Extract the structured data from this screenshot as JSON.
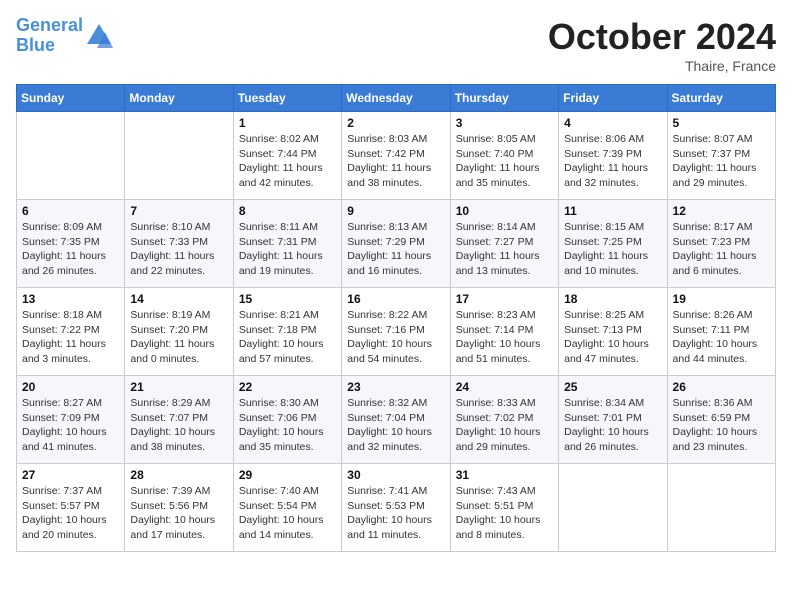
{
  "header": {
    "logo_line1": "General",
    "logo_line2": "Blue",
    "month": "October 2024",
    "location": "Thaire, France"
  },
  "weekdays": [
    "Sunday",
    "Monday",
    "Tuesday",
    "Wednesday",
    "Thursday",
    "Friday",
    "Saturday"
  ],
  "weeks": [
    [
      {
        "day": "",
        "sunrise": "",
        "sunset": "",
        "daylight": ""
      },
      {
        "day": "",
        "sunrise": "",
        "sunset": "",
        "daylight": ""
      },
      {
        "day": "1",
        "sunrise": "Sunrise: 8:02 AM",
        "sunset": "Sunset: 7:44 PM",
        "daylight": "Daylight: 11 hours and 42 minutes."
      },
      {
        "day": "2",
        "sunrise": "Sunrise: 8:03 AM",
        "sunset": "Sunset: 7:42 PM",
        "daylight": "Daylight: 11 hours and 38 minutes."
      },
      {
        "day": "3",
        "sunrise": "Sunrise: 8:05 AM",
        "sunset": "Sunset: 7:40 PM",
        "daylight": "Daylight: 11 hours and 35 minutes."
      },
      {
        "day": "4",
        "sunrise": "Sunrise: 8:06 AM",
        "sunset": "Sunset: 7:39 PM",
        "daylight": "Daylight: 11 hours and 32 minutes."
      },
      {
        "day": "5",
        "sunrise": "Sunrise: 8:07 AM",
        "sunset": "Sunset: 7:37 PM",
        "daylight": "Daylight: 11 hours and 29 minutes."
      }
    ],
    [
      {
        "day": "6",
        "sunrise": "Sunrise: 8:09 AM",
        "sunset": "Sunset: 7:35 PM",
        "daylight": "Daylight: 11 hours and 26 minutes."
      },
      {
        "day": "7",
        "sunrise": "Sunrise: 8:10 AM",
        "sunset": "Sunset: 7:33 PM",
        "daylight": "Daylight: 11 hours and 22 minutes."
      },
      {
        "day": "8",
        "sunrise": "Sunrise: 8:11 AM",
        "sunset": "Sunset: 7:31 PM",
        "daylight": "Daylight: 11 hours and 19 minutes."
      },
      {
        "day": "9",
        "sunrise": "Sunrise: 8:13 AM",
        "sunset": "Sunset: 7:29 PM",
        "daylight": "Daylight: 11 hours and 16 minutes."
      },
      {
        "day": "10",
        "sunrise": "Sunrise: 8:14 AM",
        "sunset": "Sunset: 7:27 PM",
        "daylight": "Daylight: 11 hours and 13 minutes."
      },
      {
        "day": "11",
        "sunrise": "Sunrise: 8:15 AM",
        "sunset": "Sunset: 7:25 PM",
        "daylight": "Daylight: 11 hours and 10 minutes."
      },
      {
        "day": "12",
        "sunrise": "Sunrise: 8:17 AM",
        "sunset": "Sunset: 7:23 PM",
        "daylight": "Daylight: 11 hours and 6 minutes."
      }
    ],
    [
      {
        "day": "13",
        "sunrise": "Sunrise: 8:18 AM",
        "sunset": "Sunset: 7:22 PM",
        "daylight": "Daylight: 11 hours and 3 minutes."
      },
      {
        "day": "14",
        "sunrise": "Sunrise: 8:19 AM",
        "sunset": "Sunset: 7:20 PM",
        "daylight": "Daylight: 11 hours and 0 minutes."
      },
      {
        "day": "15",
        "sunrise": "Sunrise: 8:21 AM",
        "sunset": "Sunset: 7:18 PM",
        "daylight": "Daylight: 10 hours and 57 minutes."
      },
      {
        "day": "16",
        "sunrise": "Sunrise: 8:22 AM",
        "sunset": "Sunset: 7:16 PM",
        "daylight": "Daylight: 10 hours and 54 minutes."
      },
      {
        "day": "17",
        "sunrise": "Sunrise: 8:23 AM",
        "sunset": "Sunset: 7:14 PM",
        "daylight": "Daylight: 10 hours and 51 minutes."
      },
      {
        "day": "18",
        "sunrise": "Sunrise: 8:25 AM",
        "sunset": "Sunset: 7:13 PM",
        "daylight": "Daylight: 10 hours and 47 minutes."
      },
      {
        "day": "19",
        "sunrise": "Sunrise: 8:26 AM",
        "sunset": "Sunset: 7:11 PM",
        "daylight": "Daylight: 10 hours and 44 minutes."
      }
    ],
    [
      {
        "day": "20",
        "sunrise": "Sunrise: 8:27 AM",
        "sunset": "Sunset: 7:09 PM",
        "daylight": "Daylight: 10 hours and 41 minutes."
      },
      {
        "day": "21",
        "sunrise": "Sunrise: 8:29 AM",
        "sunset": "Sunset: 7:07 PM",
        "daylight": "Daylight: 10 hours and 38 minutes."
      },
      {
        "day": "22",
        "sunrise": "Sunrise: 8:30 AM",
        "sunset": "Sunset: 7:06 PM",
        "daylight": "Daylight: 10 hours and 35 minutes."
      },
      {
        "day": "23",
        "sunrise": "Sunrise: 8:32 AM",
        "sunset": "Sunset: 7:04 PM",
        "daylight": "Daylight: 10 hours and 32 minutes."
      },
      {
        "day": "24",
        "sunrise": "Sunrise: 8:33 AM",
        "sunset": "Sunset: 7:02 PM",
        "daylight": "Daylight: 10 hours and 29 minutes."
      },
      {
        "day": "25",
        "sunrise": "Sunrise: 8:34 AM",
        "sunset": "Sunset: 7:01 PM",
        "daylight": "Daylight: 10 hours and 26 minutes."
      },
      {
        "day": "26",
        "sunrise": "Sunrise: 8:36 AM",
        "sunset": "Sunset: 6:59 PM",
        "daylight": "Daylight: 10 hours and 23 minutes."
      }
    ],
    [
      {
        "day": "27",
        "sunrise": "Sunrise: 7:37 AM",
        "sunset": "Sunset: 5:57 PM",
        "daylight": "Daylight: 10 hours and 20 minutes."
      },
      {
        "day": "28",
        "sunrise": "Sunrise: 7:39 AM",
        "sunset": "Sunset: 5:56 PM",
        "daylight": "Daylight: 10 hours and 17 minutes."
      },
      {
        "day": "29",
        "sunrise": "Sunrise: 7:40 AM",
        "sunset": "Sunset: 5:54 PM",
        "daylight": "Daylight: 10 hours and 14 minutes."
      },
      {
        "day": "30",
        "sunrise": "Sunrise: 7:41 AM",
        "sunset": "Sunset: 5:53 PM",
        "daylight": "Daylight: 10 hours and 11 minutes."
      },
      {
        "day": "31",
        "sunrise": "Sunrise: 7:43 AM",
        "sunset": "Sunset: 5:51 PM",
        "daylight": "Daylight: 10 hours and 8 minutes."
      },
      {
        "day": "",
        "sunrise": "",
        "sunset": "",
        "daylight": ""
      },
      {
        "day": "",
        "sunrise": "",
        "sunset": "",
        "daylight": ""
      }
    ]
  ]
}
